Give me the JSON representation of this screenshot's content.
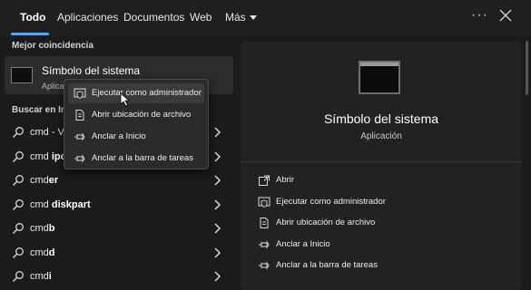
{
  "tabs": [
    {
      "label": "Todo",
      "active": true
    },
    {
      "label": "Aplicaciones"
    },
    {
      "label": "Documentos"
    },
    {
      "label": "Web"
    },
    {
      "label": "Más"
    }
  ],
  "more_options_label": "···",
  "accent_color": "#5aa6e8",
  "left": {
    "best_match_label": "Mejor coincidencia",
    "best_match": {
      "title": "Símbolo del sistema",
      "subtitle": "Aplicación",
      "icon": "terminal-icon"
    },
    "search_label": "Buscar en Internet",
    "results": [
      {
        "prefix": "cmd - V",
        "bold": ""
      },
      {
        "prefix": "cmd ",
        "bold": "ipc"
      },
      {
        "prefix": "cmd",
        "bold": "er"
      },
      {
        "prefix": "cmd ",
        "bold": "diskpart"
      },
      {
        "prefix": "cmd",
        "bold": "b"
      },
      {
        "prefix": "cmd",
        "bold": "d"
      },
      {
        "prefix": "cmd",
        "bold": "i"
      }
    ]
  },
  "context_menu": {
    "items": [
      {
        "label": "Ejecutar como administrador",
        "icon": "shield-run-icon"
      },
      {
        "label": "Abrir ubicación de archivo",
        "icon": "file-location-icon"
      },
      {
        "label": "Anclar a Inicio",
        "icon": "pin-icon"
      },
      {
        "label": "Anclar a la barra de tareas",
        "icon": "pin-taskbar-icon"
      }
    ]
  },
  "preview": {
    "title": "Símbolo del sistema",
    "subtitle": "Aplicación",
    "actions": [
      {
        "label": "Abrir",
        "icon": "open-icon"
      },
      {
        "label": "Ejecutar como administrador",
        "icon": "shield-run-icon"
      },
      {
        "label": "Abrir ubicación de archivo",
        "icon": "file-location-icon"
      },
      {
        "label": "Anclar a Inicio",
        "icon": "pin-icon"
      },
      {
        "label": "Anclar a la barra de tareas",
        "icon": "pin-taskbar-icon"
      }
    ]
  }
}
